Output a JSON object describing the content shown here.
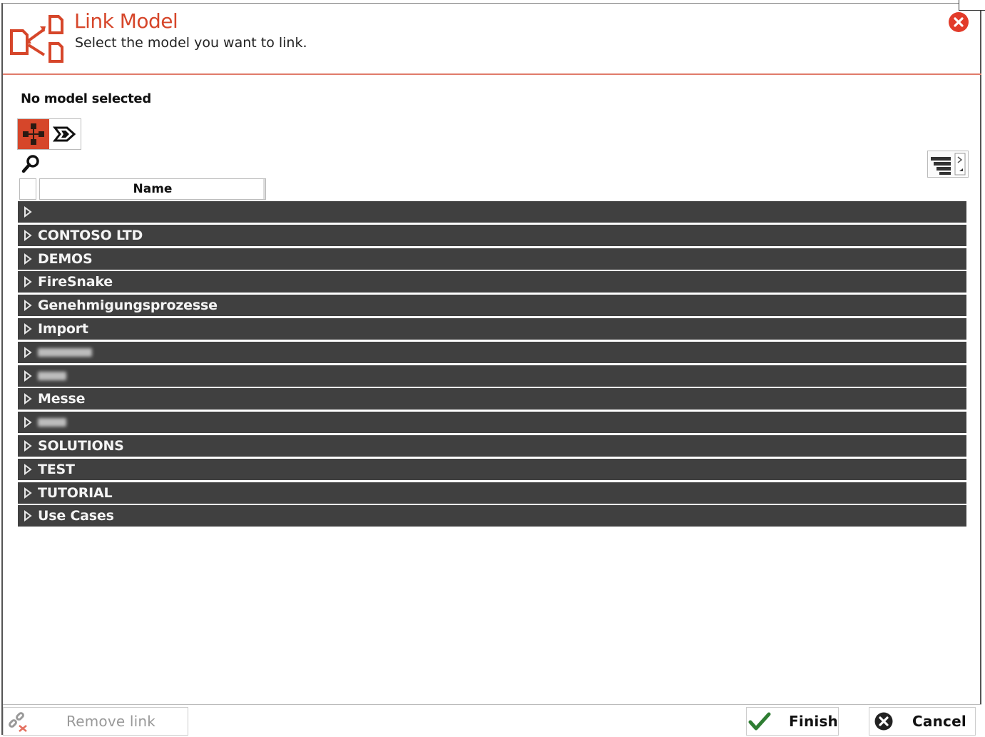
{
  "dialog": {
    "title": "Link Model",
    "subtitle": "Select the model you want to link.",
    "accent_color": "#d6462a"
  },
  "selection": {
    "status": "No model selected"
  },
  "toolbar": {
    "view_buttons": [
      "process-map-icon",
      "value-chain-icon"
    ],
    "active_view": "process-map-icon",
    "search_icon": "search-icon",
    "settings_icon": "column-settings-icon"
  },
  "table": {
    "columns": [
      "Name"
    ],
    "rows": [
      {
        "label": "",
        "blurred": false
      },
      {
        "label": "CONTOSO LTD",
        "blurred": false
      },
      {
        "label": "DEMOS",
        "blurred": false
      },
      {
        "label": "FireSnake",
        "blurred": false
      },
      {
        "label": "Genehmigungsprozesse",
        "blurred": false
      },
      {
        "label": "Import",
        "blurred": false
      },
      {
        "label": "",
        "blurred": true
      },
      {
        "label": "",
        "blurred": true
      },
      {
        "label": "Messe",
        "blurred": false
      },
      {
        "label": "",
        "blurred": true
      },
      {
        "label": "SOLUTIONS",
        "blurred": false
      },
      {
        "label": "TEST",
        "blurred": false
      },
      {
        "label": "TUTORIAL",
        "blurred": false
      },
      {
        "label": "Use Cases",
        "blurred": false
      }
    ]
  },
  "footer": {
    "remove_label": "Remove link",
    "finish_label": "Finish",
    "cancel_label": "Cancel"
  }
}
